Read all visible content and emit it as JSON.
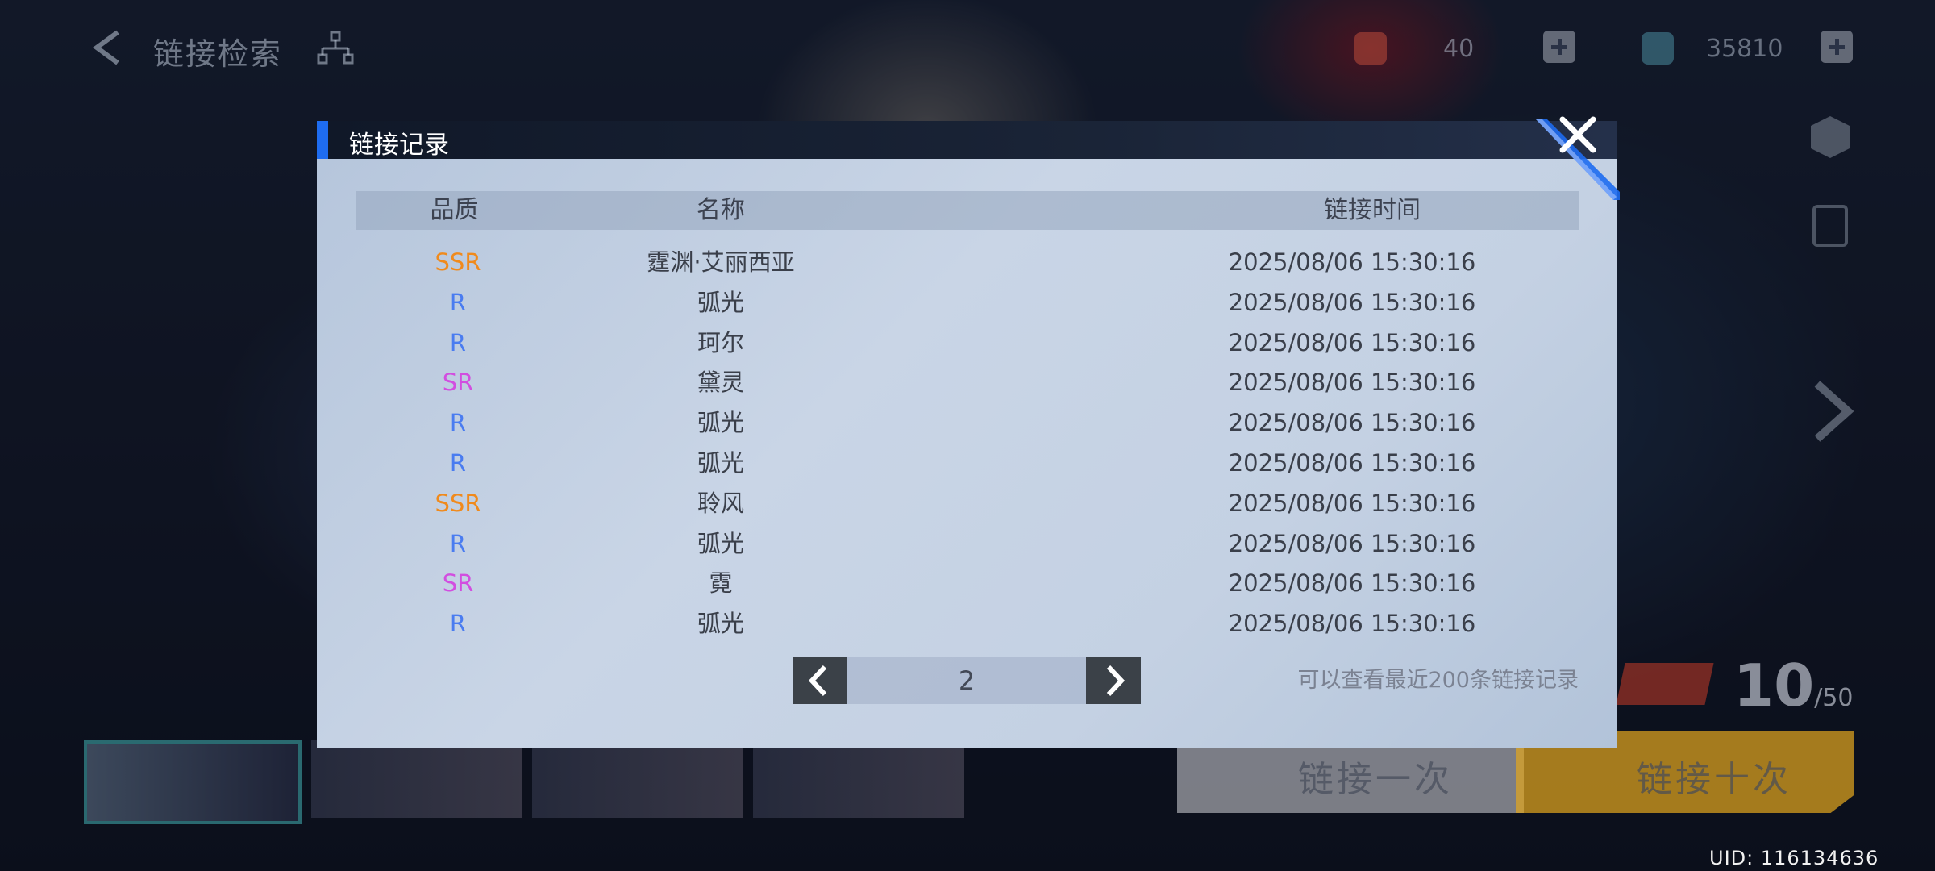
{
  "topbar": {
    "title": "链接检索",
    "resource_1": "40",
    "resource_2": "35810"
  },
  "dialog": {
    "title": "链接记录",
    "columns": {
      "quality": "品质",
      "name": "名称",
      "time": "链接时间"
    },
    "rows": [
      {
        "quality": "SSR",
        "quality_color": "#f08a1c",
        "name": "霆渊·艾丽西亚",
        "time": "2025/08/06 15:30:16"
      },
      {
        "quality": "R",
        "quality_color": "#4a7cf0",
        "name": "弧光",
        "time": "2025/08/06 15:30:16"
      },
      {
        "quality": "R",
        "quality_color": "#4a7cf0",
        "name": "珂尔",
        "time": "2025/08/06 15:30:16"
      },
      {
        "quality": "SR",
        "quality_color": "#d24ee0",
        "name": "黛灵",
        "time": "2025/08/06 15:30:16"
      },
      {
        "quality": "R",
        "quality_color": "#4a7cf0",
        "name": "弧光",
        "time": "2025/08/06 15:30:16"
      },
      {
        "quality": "R",
        "quality_color": "#4a7cf0",
        "name": "弧光",
        "time": "2025/08/06 15:30:16"
      },
      {
        "quality": "SSR",
        "quality_color": "#f08a1c",
        "name": "聆风",
        "time": "2025/08/06 15:30:16"
      },
      {
        "quality": "R",
        "quality_color": "#4a7cf0",
        "name": "弧光",
        "time": "2025/08/06 15:30:16"
      },
      {
        "quality": "SR",
        "quality_color": "#d24ee0",
        "name": "霓",
        "time": "2025/08/06 15:30:16"
      },
      {
        "quality": "R",
        "quality_color": "#4a7cf0",
        "name": "弧光",
        "time": "2025/08/06 15:30:16"
      }
    ],
    "pager": {
      "page": "2"
    },
    "hint": "可以查看最近200条链接记录"
  },
  "bottom": {
    "pull_once": "链接一次",
    "pull_ten": "链接十次",
    "count": "10",
    "count_max": "/50"
  },
  "uid": "UID: 116134636",
  "colors": {
    "accent": "#1e6cf0",
    "header_bg": "#101828"
  }
}
